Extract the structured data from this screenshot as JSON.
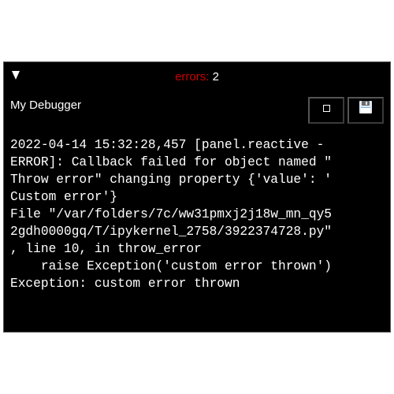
{
  "header": {
    "toggle_icon": "triangle-down-icon",
    "errors_label": "errors: ",
    "errors_count": "2"
  },
  "title": "My Debugger",
  "buttons": {
    "clear_icon": "square-icon",
    "save_icon": "floppy-disk-icon"
  },
  "log_lines": [
    "2022-04-14 15:32:28,457 [panel.reactive -",
    "ERROR]: Callback failed for object named \"",
    "Throw error\" changing property {'value': '",
    "Custom error'}",
    "File \"/var/folders/7c/ww31pmxj2j18w_mn_qy5",
    "2gdh0000gq/T/ipykernel_2758/3922374728.py\"",
    ", line 10, in throw_error",
    "    raise Exception('custom error thrown')",
    "Exception: custom error thrown"
  ],
  "colors": {
    "error_label": "#cc0000",
    "background": "#000000",
    "text": "#ffffff"
  }
}
